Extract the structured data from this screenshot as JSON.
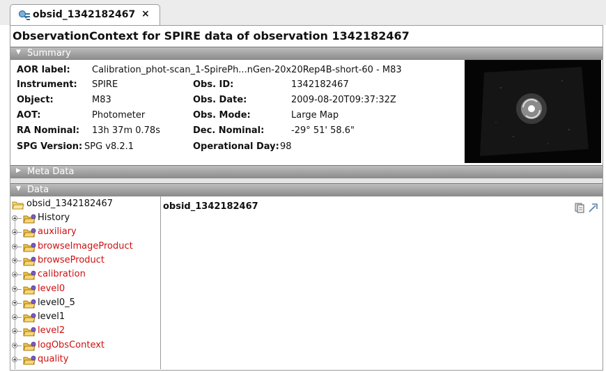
{
  "tab": {
    "label": "obsid_1342182467",
    "close": "×"
  },
  "title": "ObservationContext for SPIRE data of observation 1342182467",
  "sections": {
    "summary": "Summary",
    "meta": "Meta Data",
    "data": "Data"
  },
  "summary": {
    "aor_label": {
      "key": "AOR label:",
      "value": "Calibration_phot-scan_1-SpirePh...nGen-20x20Rep4B-short-60 - M83"
    },
    "instrument": {
      "key": "Instrument:",
      "value": "SPIRE"
    },
    "object": {
      "key": "Object:",
      "value": "M83"
    },
    "aot": {
      "key": "AOT:",
      "value": "Photometer"
    },
    "ra_nominal": {
      "key": "RA Nominal:",
      "value": "13h 37m 0.78s"
    },
    "spg_version": {
      "key": "SPG Version:",
      "value": "SPG v8.2.1"
    },
    "obs_id": {
      "key": "Obs. ID:",
      "value": "1342182467"
    },
    "obs_date": {
      "key": "Obs. Date:",
      "value": "2009-08-20T09:37:32Z"
    },
    "obs_mode": {
      "key": "Obs. Mode:",
      "value": "Large Map"
    },
    "dec_nominal": {
      "key": "Dec. Nominal:",
      "value": "-29° 51' 58.6\""
    },
    "operational_day": {
      "key": "Operational Day:",
      "value": "98"
    }
  },
  "tree": {
    "root": "obsid_1342182467",
    "children": [
      {
        "label": "History",
        "color": "#111111"
      },
      {
        "label": "auxiliary",
        "color": "#cc1111"
      },
      {
        "label": "browseImageProduct",
        "color": "#cc1111"
      },
      {
        "label": "browseProduct",
        "color": "#cc1111"
      },
      {
        "label": "calibration",
        "color": "#cc1111"
      },
      {
        "label": "level0",
        "color": "#cc1111"
      },
      {
        "label": "level0_5",
        "color": "#111111"
      },
      {
        "label": "level1",
        "color": "#111111"
      },
      {
        "label": "level2",
        "color": "#cc1111"
      },
      {
        "label": "logObsContext",
        "color": "#cc1111"
      },
      {
        "label": "quality",
        "color": "#cc1111"
      }
    ]
  },
  "content": {
    "title": "obsid_1342182467"
  },
  "icons": {
    "tab": "observation-context-icon",
    "copy": "copy-icon",
    "popout": "popout-icon",
    "folder": "folder-icon"
  }
}
